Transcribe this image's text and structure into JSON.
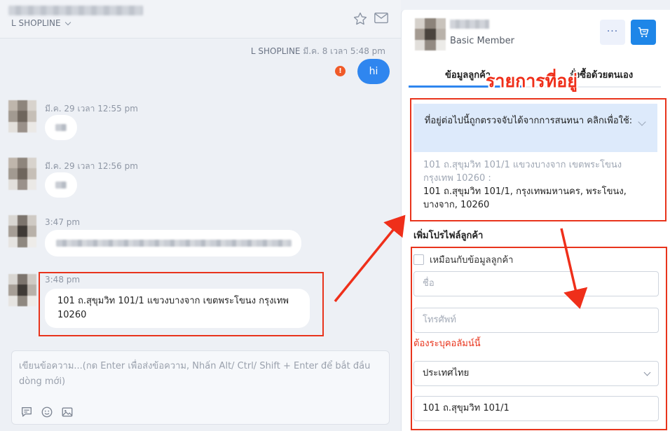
{
  "chat": {
    "header": {
      "store_name": "L SHOPLINE"
    },
    "outgoing": {
      "sender": "L SHOPLINE",
      "time": "มี.ค. 8 เวลา 5:48 pm",
      "text": "hi",
      "error_mark": "!"
    },
    "messages": [
      {
        "time": "มี.ค. 29 เวลา 12:55 pm"
      },
      {
        "time": "มี.ค. 29 เวลา 12:56 pm"
      },
      {
        "time": "3:47 pm"
      },
      {
        "time": "3:48 pm",
        "text": "101 ถ.สุขุมวิท 101/1 แขวงบางจาก เขตพระโขนง กรุงเทพ 10260"
      }
    ],
    "composer": {
      "placeholder": "เขียนข้อความ...(กด Enter เพื่อส่งข้อความ, Nhấn Alt/ Ctrl/ Shift + Enter để bắt đầu dòng mới)"
    }
  },
  "panel": {
    "member_level": "Basic Member",
    "more_label": "···",
    "tabs": [
      {
        "label": "ข้อมูลลูกค้า",
        "active": true
      },
      {
        "label": "สั่งซื้อด้วยตนเอง",
        "active": false
      }
    ],
    "annotation_label": "รายการที่อยู่",
    "detected": {
      "title": "ที่อยู่ต่อไปนี้ถูกตรวจจับได้จากการสนทนา คลิกเพื่อใช้:",
      "raw": "101 ถ.สุขุมวิท 101/1 แขวงบางจาก เขตพระโขนง กรุงเทพ 10260 :",
      "parsed": "101 ถ.สุขุมวิท 101/1, กรุงเทพมหานคร, พระโขนง, บางจาก, 10260"
    },
    "profile": {
      "section_title": "เพิ่มโปรไฟล์ลูกค้า",
      "same_as_label": "เหมือนกับข้อมูลลูกค้า",
      "name_placeholder": "ชื่อ",
      "phone_placeholder": "โทรศัพท์",
      "required_error": "ต้องระบุคอลัมน์นี้",
      "country_value": "ประเทศไทย",
      "address_value": "101 ถ.สุขุมวิท 101/1"
    }
  },
  "colors": {
    "accent": "#2f86ef",
    "annotation_red": "#e8341c",
    "error": "#f05a28"
  },
  "icons": [
    "star-icon",
    "mail-icon",
    "chevron-down-icon",
    "cart-icon",
    "more-icon",
    "message-template-icon",
    "emoji-icon",
    "image-icon",
    "checkbox-icon",
    "arrow-annotation"
  ]
}
